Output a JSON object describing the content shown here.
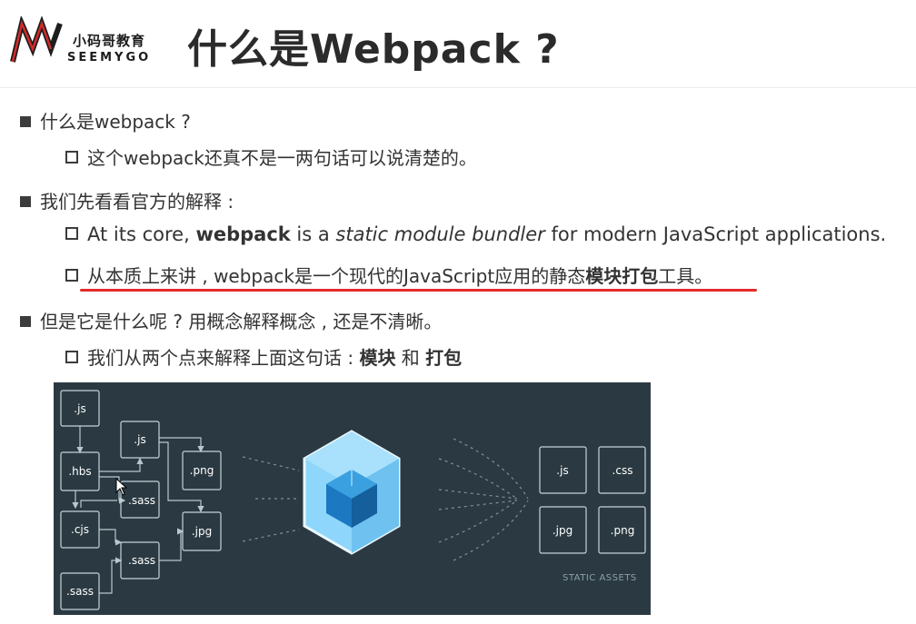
{
  "logo": {
    "cn": "小码哥教育",
    "en": "SEEMYGO"
  },
  "title": "什么是Webpack ?",
  "bullets": {
    "q1": "什么是webpack ?",
    "q1_sub": "这个webpack还真不是一两句话可以说清楚的。",
    "q2": "我们先看看官方的解释 :",
    "q2_sub_en": {
      "p1": "At its core, ",
      "b1": "webpack",
      "p2": " is a ",
      "i1": "static module bundler",
      "p3": " for modern JavaScript applications."
    },
    "q2_sub_cn": {
      "p1": "从本质上来讲 , webpack是一个现代的JavaScript应用的静态",
      "b1": "模块打包",
      "p2": "工具。"
    },
    "q3": "但是它是什么呢 ? 用概念解释概念 , 还是不清晰。",
    "q3_sub": {
      "p1": "我们从两个点来解释上面这句话 : ",
      "b1": "模块",
      "p2": " 和 ",
      "b2": "打包"
    }
  },
  "diagram": {
    "modules": [
      ".js",
      ".hbs",
      ".cjs",
      ".sass",
      ".js",
      ".sass",
      ".sass",
      ".png",
      ".jpg"
    ],
    "assets": [
      ".js",
      ".css",
      ".jpg",
      ".png"
    ],
    "assets_label": "STATIC ASSETS"
  },
  "colors": {
    "accent_underline": "#e52b2b",
    "diagram_bg": "#2b3a42",
    "cube_light": "#8ed6fb",
    "cube_dark": "#1c78c0"
  }
}
